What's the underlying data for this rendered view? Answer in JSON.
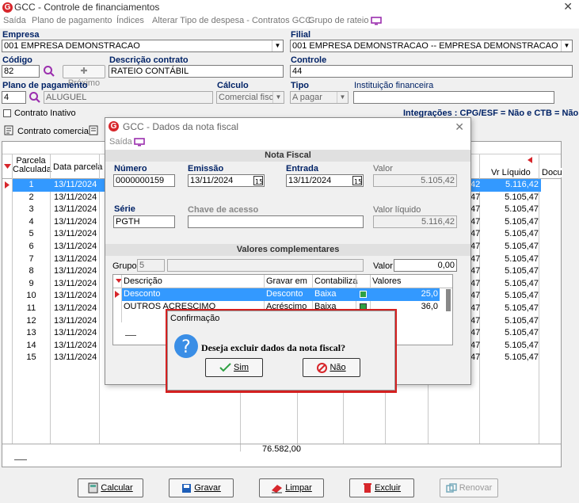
{
  "window": {
    "title": "GCC - Controle de financiamentos",
    "close": "✕"
  },
  "menu": [
    "Saída",
    "Plano de pagamento",
    "Índices",
    "Alterar Tipo de despesa - Contratos GCC",
    "Grupo de rateio"
  ],
  "form": {
    "empresa_label": "Empresa",
    "empresa_value": "001 EMPRESA DEMONSTRACAO",
    "filial_label": "Filial",
    "filial_value": "001 EMPRESA DEMONSTRACAO -- EMPRESA DEMONSTRACAO",
    "codigo_label": "Código",
    "codigo_value": "82",
    "proximo_label": "Próximo",
    "descricao_label": "Descrição contrato",
    "descricao_value": "RATEIO CONTÁBIL",
    "controle_label": "Controle",
    "controle_value": "44",
    "plano_label": "Plano de pagamento",
    "plano_code": "4",
    "plano_name": "ALUGUEL",
    "calculo_label": "Cálculo",
    "calculo_value": "Comercial fiscal",
    "tipo_label": "Tipo",
    "tipo_value": "A pagar",
    "instituicao_label": "Instituição financeira",
    "instituicao_value": "",
    "inativo_label": "Contrato Inativo",
    "integracoes": "Integrações : CPG/ESF = Não e CTB = Não"
  },
  "tabs": {
    "contrato_comercial": "Contrato comercial"
  },
  "main_grid": {
    "headers": {
      "parcela": "Parcela Calculada",
      "data": "Data parcela",
      "vl_liquido": "Vr Líquido",
      "docu": "Docu"
    },
    "rows": [
      {
        "n": "1",
        "d": "13/11/2024",
        "p": "42",
        "v": "5.116,42"
      },
      {
        "n": "2",
        "d": "13/11/2024",
        "p": "47",
        "v": "5.105,47"
      },
      {
        "n": "3",
        "d": "13/11/2024",
        "p": "47",
        "v": "5.105,47"
      },
      {
        "n": "4",
        "d": "13/11/2024",
        "p": "47",
        "v": "5.105,47"
      },
      {
        "n": "5",
        "d": "13/11/2024",
        "p": "47",
        "v": "5.105,47"
      },
      {
        "n": "6",
        "d": "13/11/2024",
        "p": "47",
        "v": "5.105,47"
      },
      {
        "n": "7",
        "d": "13/11/2024",
        "p": "47",
        "v": "5.105,47"
      },
      {
        "n": "8",
        "d": "13/11/2024",
        "p": "47",
        "v": "5.105,47"
      },
      {
        "n": "9",
        "d": "13/11/2024",
        "p": "47",
        "v": "5.105,47"
      },
      {
        "n": "10",
        "d": "13/11/2024",
        "p": "47",
        "v": "5.105,47"
      },
      {
        "n": "11",
        "d": "13/11/2024",
        "p": "47",
        "v": "5.105,47"
      },
      {
        "n": "12",
        "d": "13/11/2024",
        "p": "47",
        "v": "5.105,47"
      },
      {
        "n": "13",
        "d": "13/11/2024",
        "p": "47",
        "v": "5.105,47"
      },
      {
        "n": "14",
        "d": "13/11/2024",
        "p": "47",
        "v": "5.105,47"
      },
      {
        "n": "15",
        "d": "13/11/2024",
        "p": "47",
        "v": "5.105,47"
      }
    ],
    "total": "76.582,00"
  },
  "buttons": {
    "calcular": "Calcular",
    "gravar": "Gravar",
    "limpar": "Limpar",
    "excluir": "Excluir",
    "renovar": "Renovar"
  },
  "nf_dialog": {
    "title": "GCC - Dados da nota fiscal",
    "menu_saida": "Saída",
    "section_nf": "Nota Fiscal",
    "numero_label": "Número",
    "numero_value": "0000000159",
    "emissao_label": "Emissão",
    "emissao_value": "13/11/2024",
    "entrada_label": "Entrada",
    "entrada_value": "13/11/2024",
    "valor_label": "Valor",
    "valor_value": "5.105,42",
    "serie_label": "Série",
    "serie_value": "PGTH",
    "chave_label": "Chave de acesso",
    "chave_value": "",
    "valor_liquido_label": "Valor líquido",
    "valor_liquido_value": "5.116,42",
    "section_vc": "Valores complementares",
    "grupo_label": "Grupo",
    "grupo_value": "5",
    "vc_valor_label": "Valor",
    "vc_valor_value": "0,00",
    "vc_headers": {
      "descricao": "Descrição",
      "gravar_em": "Gravar em",
      "contabiliza": "Contabiliza",
      "valores": "Valores"
    },
    "vc_rows": [
      {
        "descricao": "Desconto",
        "gravar_em": "Desconto",
        "contabiliza": "Baixa",
        "valores": "25,0"
      },
      {
        "descricao": "OUTROS ACRESCIMO",
        "gravar_em": "Acréscimo",
        "contabiliza": "Baixa",
        "valores": "36,0"
      }
    ]
  },
  "confirm": {
    "title": "Confirmação",
    "message": "Deseja excluir dados da nota fiscal?",
    "sim": "Sim",
    "nao": "Não"
  },
  "colors": {
    "highlight": "#3399ff",
    "accent": "#d7262b",
    "label": "#002266",
    "frame": "#d42020"
  }
}
